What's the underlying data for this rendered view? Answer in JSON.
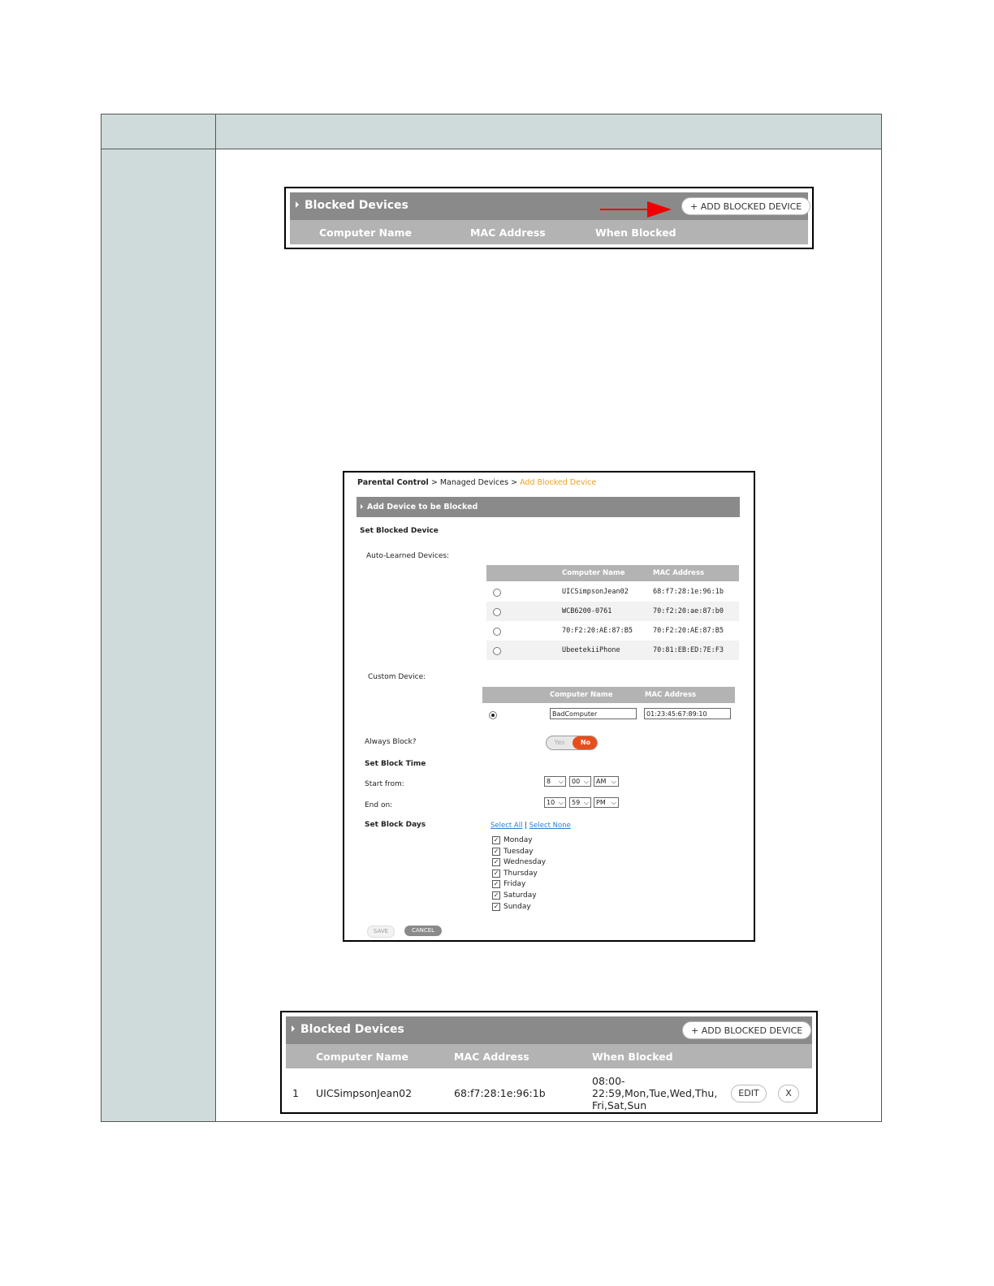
{
  "blocked_panel_1": {
    "title": "Blocked Devices",
    "add_button": "+ ADD BLOCKED DEVICE",
    "columns": [
      "Computer Name",
      "MAC Address",
      "When Blocked"
    ]
  },
  "form": {
    "breadcrumb": {
      "part1": "Parental Control",
      "sep1": ">",
      "part2": "Managed Devices",
      "sep2": ">",
      "current": "Add Blocked Device"
    },
    "section_title": "Add Device to be Blocked",
    "set_blocked_device": "Set Blocked Device",
    "auto_learned_label": "Auto-Learned Devices:",
    "auto_columns": [
      "Computer Name",
      "MAC Address"
    ],
    "auto_rows": [
      {
        "name": "UICSimpsonJean02",
        "mac": "68:f7:28:1e:96:1b"
      },
      {
        "name": "WCB6200-0761",
        "mac": "70:f2:20:ae:87:b0"
      },
      {
        "name": "70:F2:20:AE:87:B5",
        "mac": "70:F2:20:AE:87:B5"
      },
      {
        "name": "UbeetekiiPhone",
        "mac": "70:81:EB:ED:7E:F3"
      }
    ],
    "custom_label": "Custom Device:",
    "custom_columns": [
      "Computer Name",
      "MAC Address"
    ],
    "custom_name_value": "BadComputer",
    "custom_mac_value": "01:23:45:67:89:10",
    "always_block_label": "Always Block?",
    "toggle_yes": "Yes",
    "toggle_no": "No",
    "set_block_time": "Set Block Time",
    "start_label": "Start from:",
    "start_hour": "8",
    "start_min": "00",
    "start_ampm": "AM",
    "end_label": "End on:",
    "end_hour": "10",
    "end_min": "59",
    "end_ampm": "PM",
    "set_block_days": "Set Block Days",
    "select_all": "Select All",
    "select_sep": "|",
    "select_none": "Select None",
    "days": [
      "Monday",
      "Tuesday",
      "Wednesday",
      "Thursday",
      "Friday",
      "Saturday",
      "Sunday"
    ],
    "check_mark": "✓",
    "save": "SAVE",
    "cancel": "CANCEL"
  },
  "blocked_panel_2": {
    "title": "Blocked Devices",
    "add_button": "+ ADD BLOCKED DEVICE",
    "columns": [
      "Computer Name",
      "MAC Address",
      "When Blocked"
    ],
    "row": {
      "index": "1",
      "name": "UICSimpsonJean02",
      "mac": "68:f7:28:1e:96:1b",
      "when_line1": "08:00-",
      "when_line2": "22:59,Mon,Tue,Wed,Thu,",
      "when_line3": "Fri,Sat,Sun",
      "edit": "EDIT",
      "delete": "X"
    }
  },
  "colors": {
    "sidebar": "#cfdbdb",
    "bar": "#8a8a8a",
    "header_row": "#b3b3b3",
    "arrow": "#ee0000",
    "toggle_no": "#e84e1b",
    "breadcrumb_current": "#f0a020",
    "link": "#2a7dd1"
  }
}
